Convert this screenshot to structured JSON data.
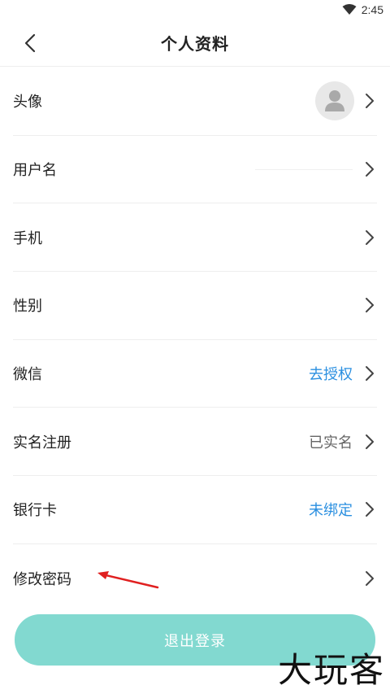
{
  "status_bar": {
    "time": "2:45"
  },
  "header": {
    "title": "个人资料"
  },
  "rows": [
    {
      "label": "头像",
      "value": ""
    },
    {
      "label": "用户名",
      "value": ""
    },
    {
      "label": "手机",
      "value": ""
    },
    {
      "label": "性别",
      "value": ""
    },
    {
      "label": "微信",
      "value": "去授权"
    },
    {
      "label": "实名注册",
      "value": "已实名"
    },
    {
      "label": "银行卡",
      "value": "未绑定"
    },
    {
      "label": "修改密码",
      "value": ""
    }
  ],
  "logout": {
    "label": "退出登录"
  },
  "watermark": "大玩客",
  "colors": {
    "accent": "#2a8fe0",
    "button": "#82d9d0",
    "annotation": "#e02020"
  },
  "icons": {
    "back": "chevron-left-icon",
    "row": "chevron-right-icon",
    "avatar": "person-icon",
    "wifi": "wifi-icon"
  }
}
